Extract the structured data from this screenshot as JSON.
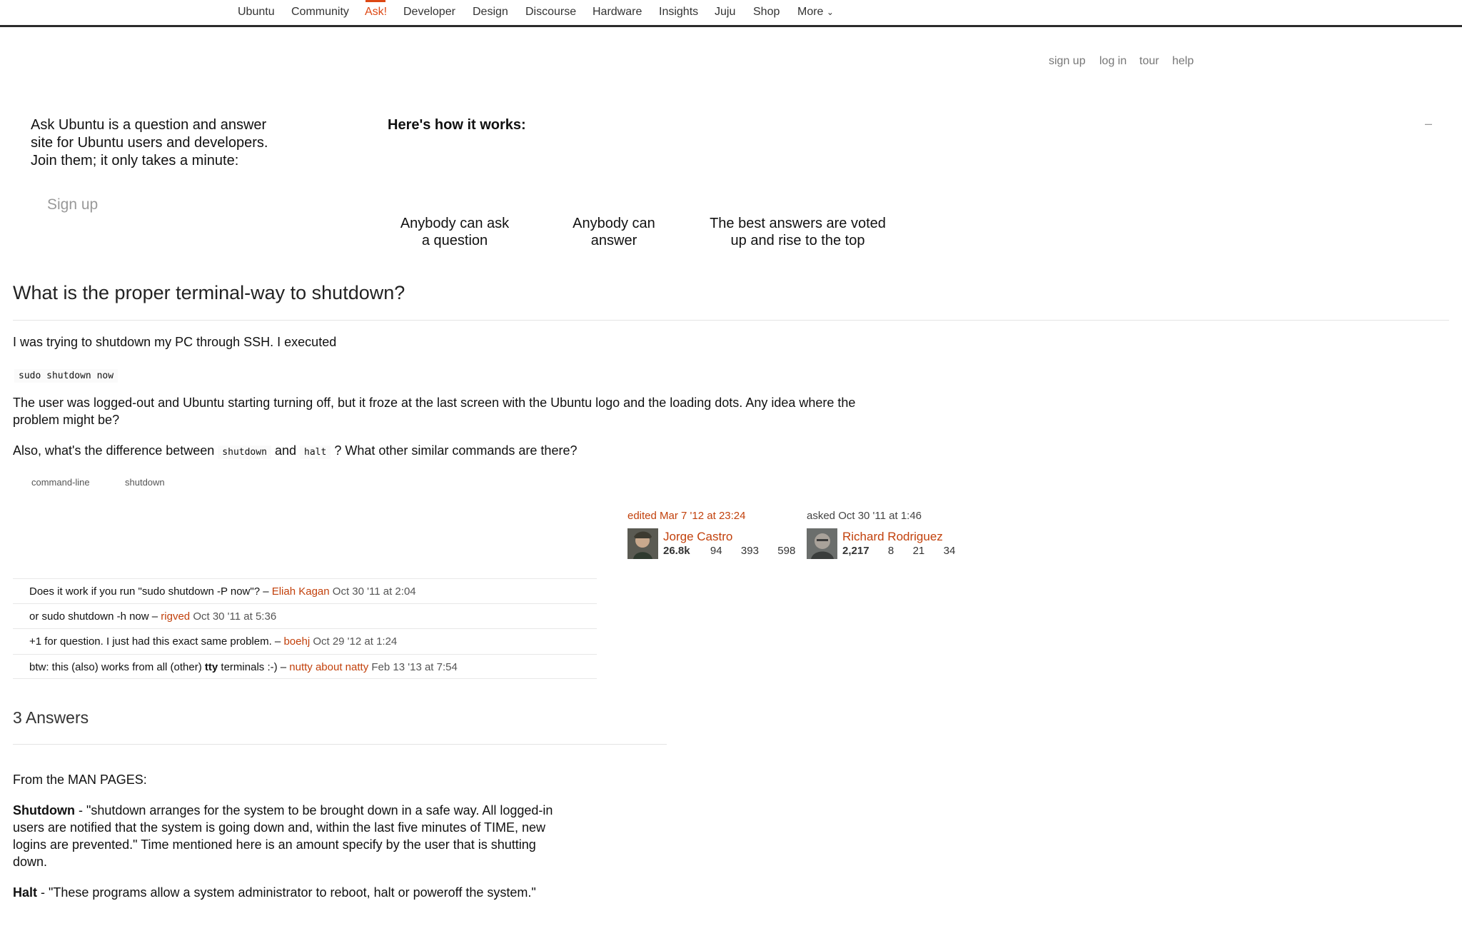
{
  "topnav": {
    "items": [
      "Ubuntu",
      "Community",
      "Ask!",
      "Developer",
      "Design",
      "Discourse",
      "Hardware",
      "Insights",
      "Juju",
      "Shop",
      "More"
    ],
    "active": "Ask!",
    "more_chevron": "⌄"
  },
  "toplinks": [
    "sign up",
    "log in",
    "tour",
    "help"
  ],
  "intro": {
    "text_lines": [
      "Ask Ubuntu is a question and answer",
      "site for Ubuntu users and developers.",
      "Join them; it only takes a minute:"
    ],
    "signup": "Sign up",
    "how_title": "Here's how it works:",
    "how_items": [
      [
        "Anybody can ask",
        "a question"
      ],
      [
        "Anybody can",
        "answer"
      ],
      [
        "The best answers are voted",
        "up and rise to the top"
      ]
    ],
    "collapse": "–"
  },
  "question": {
    "title": "What is the proper terminal-way to shutdown?",
    "p1": "I was trying to shutdown my PC through SSH. I executed",
    "code": "sudo shutdown now",
    "p2_line1": "The user was logged-out and Ubuntu starting turning off, but it froze at the last screen with the Ubuntu logo and the loading dots. Any idea where the",
    "p2_line2": "problem might be?",
    "p3_a": "Also, what's the difference between",
    "p3_code1": "shutdown",
    "p3_b": "and",
    "p3_code2": "halt",
    "p3_c": "? What other similar commands are there?",
    "tags": [
      "command-line",
      "shutdown"
    ],
    "edited": {
      "label": "edited Mar 7 '12 at 23:24",
      "name": "Jorge Castro",
      "rep": "26.8k",
      "gold": "94",
      "silver": "393",
      "bronze": "598"
    },
    "asked": {
      "label": "asked Oct 30 '11 at 1:46",
      "name": "Richard Rodriguez",
      "rep": "2,217",
      "gold": "8",
      "silver": "21",
      "bronze": "34"
    }
  },
  "comments": [
    {
      "text": "Does it work if you run \"sudo shutdown -P now\"? –",
      "user": "Eliah Kagan",
      "date": "Oct 30 '11 at 2:04"
    },
    {
      "text": "or sudo shutdown -h now –",
      "user": "rigved",
      "date": "Oct 30 '11 at 5:36"
    },
    {
      "text": "+1 for question. I just had this exact same problem. –",
      "user": "boehj",
      "date": "Oct 29 '12 at 1:24"
    },
    {
      "text_a": "btw: this (also) works from all (other)",
      "text_bold": "tty",
      "text_b": "terminals :-) –",
      "user": "nutty about natty",
      "date": "Feb 13 '13 at 7:54"
    }
  ],
  "answers": {
    "heading": "3 Answers",
    "intro": "From the MAN PAGES:",
    "shutdown_term": "Shutdown",
    "shutdown_lines": [
      " - \"shutdown arranges for the system to be brought down in a safe way. All logged-in",
      "users are notified that the system is going down and, within the last five minutes of TIME, new",
      "logins are prevented.\" Time mentioned here is an amount specify by the user that is shutting",
      "down."
    ],
    "halt_term": "Halt",
    "halt_text": " - \"These programs allow a system administrator to reboot, halt or poweroff the system.\""
  },
  "colors": {
    "accent": "#dd4814",
    "link": "#c2410c",
    "muted": "#777777"
  }
}
